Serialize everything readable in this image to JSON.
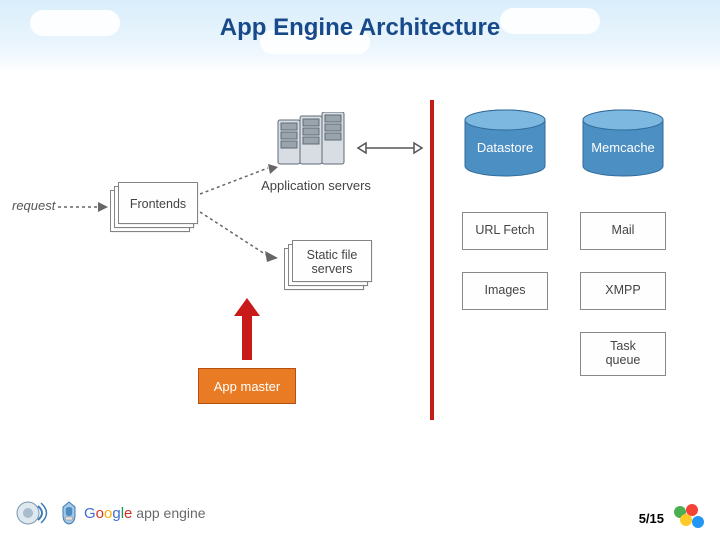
{
  "title": "App Engine Architecture",
  "slide_number": "5/15",
  "diagram": {
    "request_label": "request",
    "frontends": "Frontends",
    "app_servers_label": "Application servers",
    "static_file_servers": "Static file\nservers",
    "app_master": "App master",
    "datastore": "Datastore",
    "memcache": "Memcache",
    "url_fetch": "URL Fetch",
    "mail": "Mail",
    "images": "Images",
    "xmpp": "XMPP",
    "task_queue": "Task\nqueue"
  },
  "logo": {
    "google": "Google",
    "app_engine": " app engine"
  }
}
